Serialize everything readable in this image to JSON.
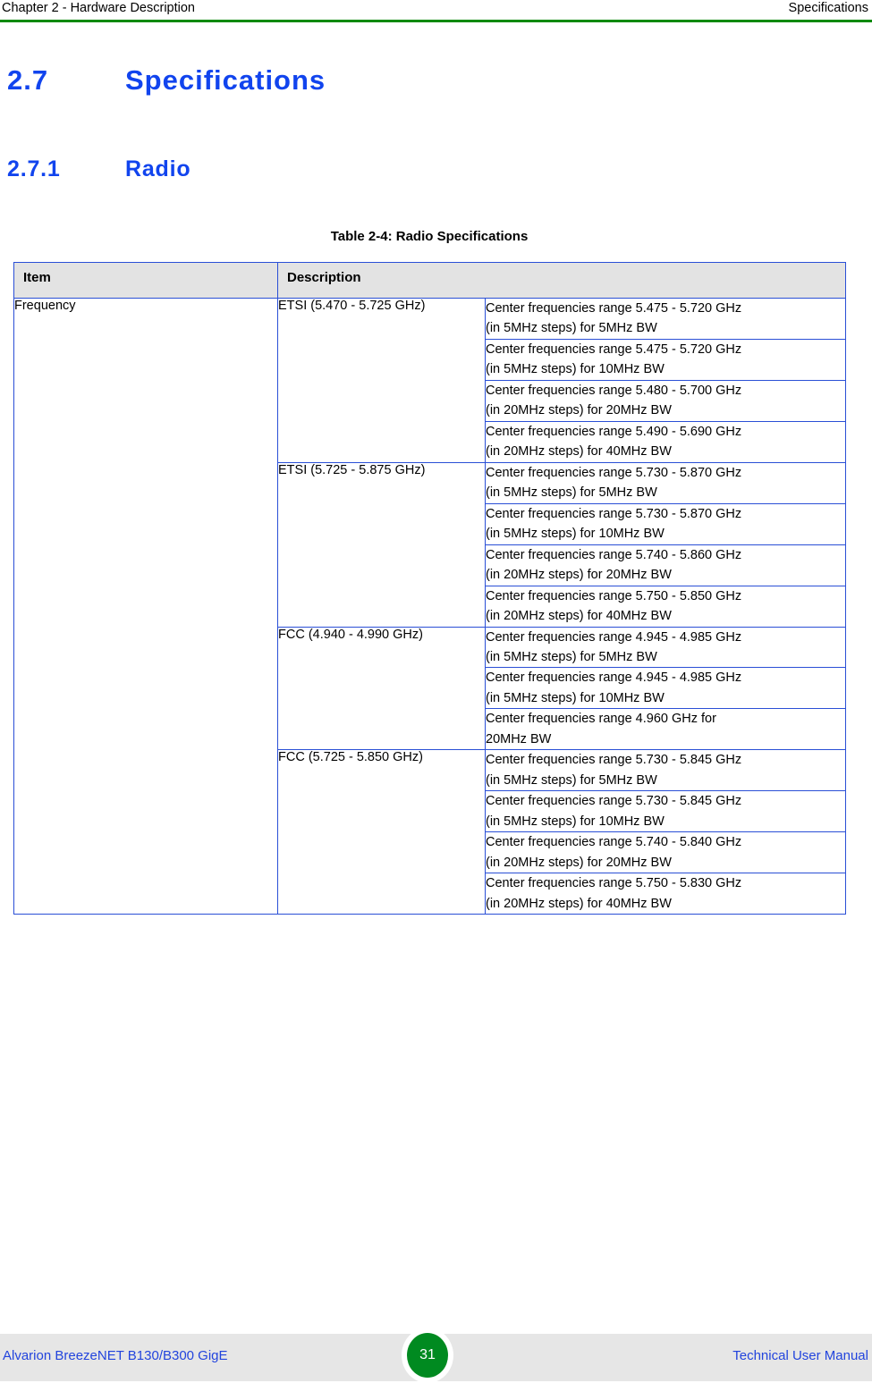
{
  "header": {
    "left": "Chapter 2 - Hardware Description",
    "right": "Specifications",
    "rule_color": "#0A8A0A"
  },
  "headings": {
    "h1_number": "2.7",
    "h1_title": "Specifications",
    "h2_number": "2.7.1",
    "h2_title": "Radio",
    "color": "#1144EE"
  },
  "table": {
    "caption": "Table 2-4: Radio Specifications",
    "border_color": "#2A4FD6",
    "header_bg": "#E3E3E3",
    "columns": [
      "Item",
      "Description"
    ],
    "item_label": "Frequency",
    "groups": [
      {
        "band": "ETSI (5.470 - 5.725 GHz)",
        "rows": [
          {
            "line1": "Center frequencies range 5.475 - 5.720 GHz",
            "line2": "(in 5MHz steps) for 5MHz BW"
          },
          {
            "line1": "Center frequencies range 5.475 - 5.720 GHz",
            "line2": "(in 5MHz steps) for 10MHz BW"
          },
          {
            "line1": "Center frequencies range 5.480 - 5.700 GHz",
            "line2": "(in 20MHz steps) for 20MHz BW"
          },
          {
            "line1": "Center frequencies range 5.490 - 5.690 GHz",
            "line2": "(in 20MHz steps) for 40MHz BW"
          }
        ]
      },
      {
        "band": "ETSI (5.725 - 5.875 GHz)",
        "rows": [
          {
            "line1": "Center frequencies range 5.730 - 5.870 GHz",
            "line2": "(in 5MHz steps) for 5MHz BW"
          },
          {
            "line1": "Center frequencies range 5.730 - 5.870 GHz",
            "line2": "(in 5MHz steps) for 10MHz BW"
          },
          {
            "line1": "Center frequencies range 5.740 - 5.860 GHz",
            "line2": "(in 20MHz steps) for 20MHz BW"
          },
          {
            "line1": "Center frequencies range 5.750 - 5.850 GHz",
            "line2": "(in 20MHz steps) for 40MHz BW"
          }
        ]
      },
      {
        "band": "FCC (4.940 - 4.990 GHz)",
        "rows": [
          {
            "line1": "Center frequencies range 4.945 - 4.985 GHz",
            "line2": "(in 5MHz steps) for 5MHz BW"
          },
          {
            "line1": "Center frequencies range 4.945 - 4.985 GHz",
            "line2": "(in 5MHz steps) for 10MHz BW"
          },
          {
            "line1": "Center frequencies range 4.960 GHz for",
            "line2": "20MHz BW"
          }
        ]
      },
      {
        "band": "FCC (5.725 - 5.850 GHz)",
        "rows": [
          {
            "line1": "Center frequencies range 5.730 - 5.845 GHz",
            "line2": "(in 5MHz steps) for 5MHz BW"
          },
          {
            "line1": "Center frequencies range 5.730 - 5.845 GHz",
            "line2": "(in 5MHz steps) for 10MHz BW"
          },
          {
            "line1": "Center frequencies range 5.740 - 5.840 GHz",
            "line2": "(in 20MHz steps) for 20MHz BW"
          },
          {
            "line1": "Center frequencies range 5.750 - 5.830 GHz",
            "line2": "(in 20MHz steps) for 40MHz BW"
          }
        ]
      }
    ]
  },
  "footer": {
    "left": "Alvarion BreezeNET B130/B300 GigE",
    "page_number": "31",
    "right": "Technical User Manual",
    "badge_color": "#008A20",
    "band_bg": "#E6E6E6",
    "text_color": "#2244DD"
  }
}
